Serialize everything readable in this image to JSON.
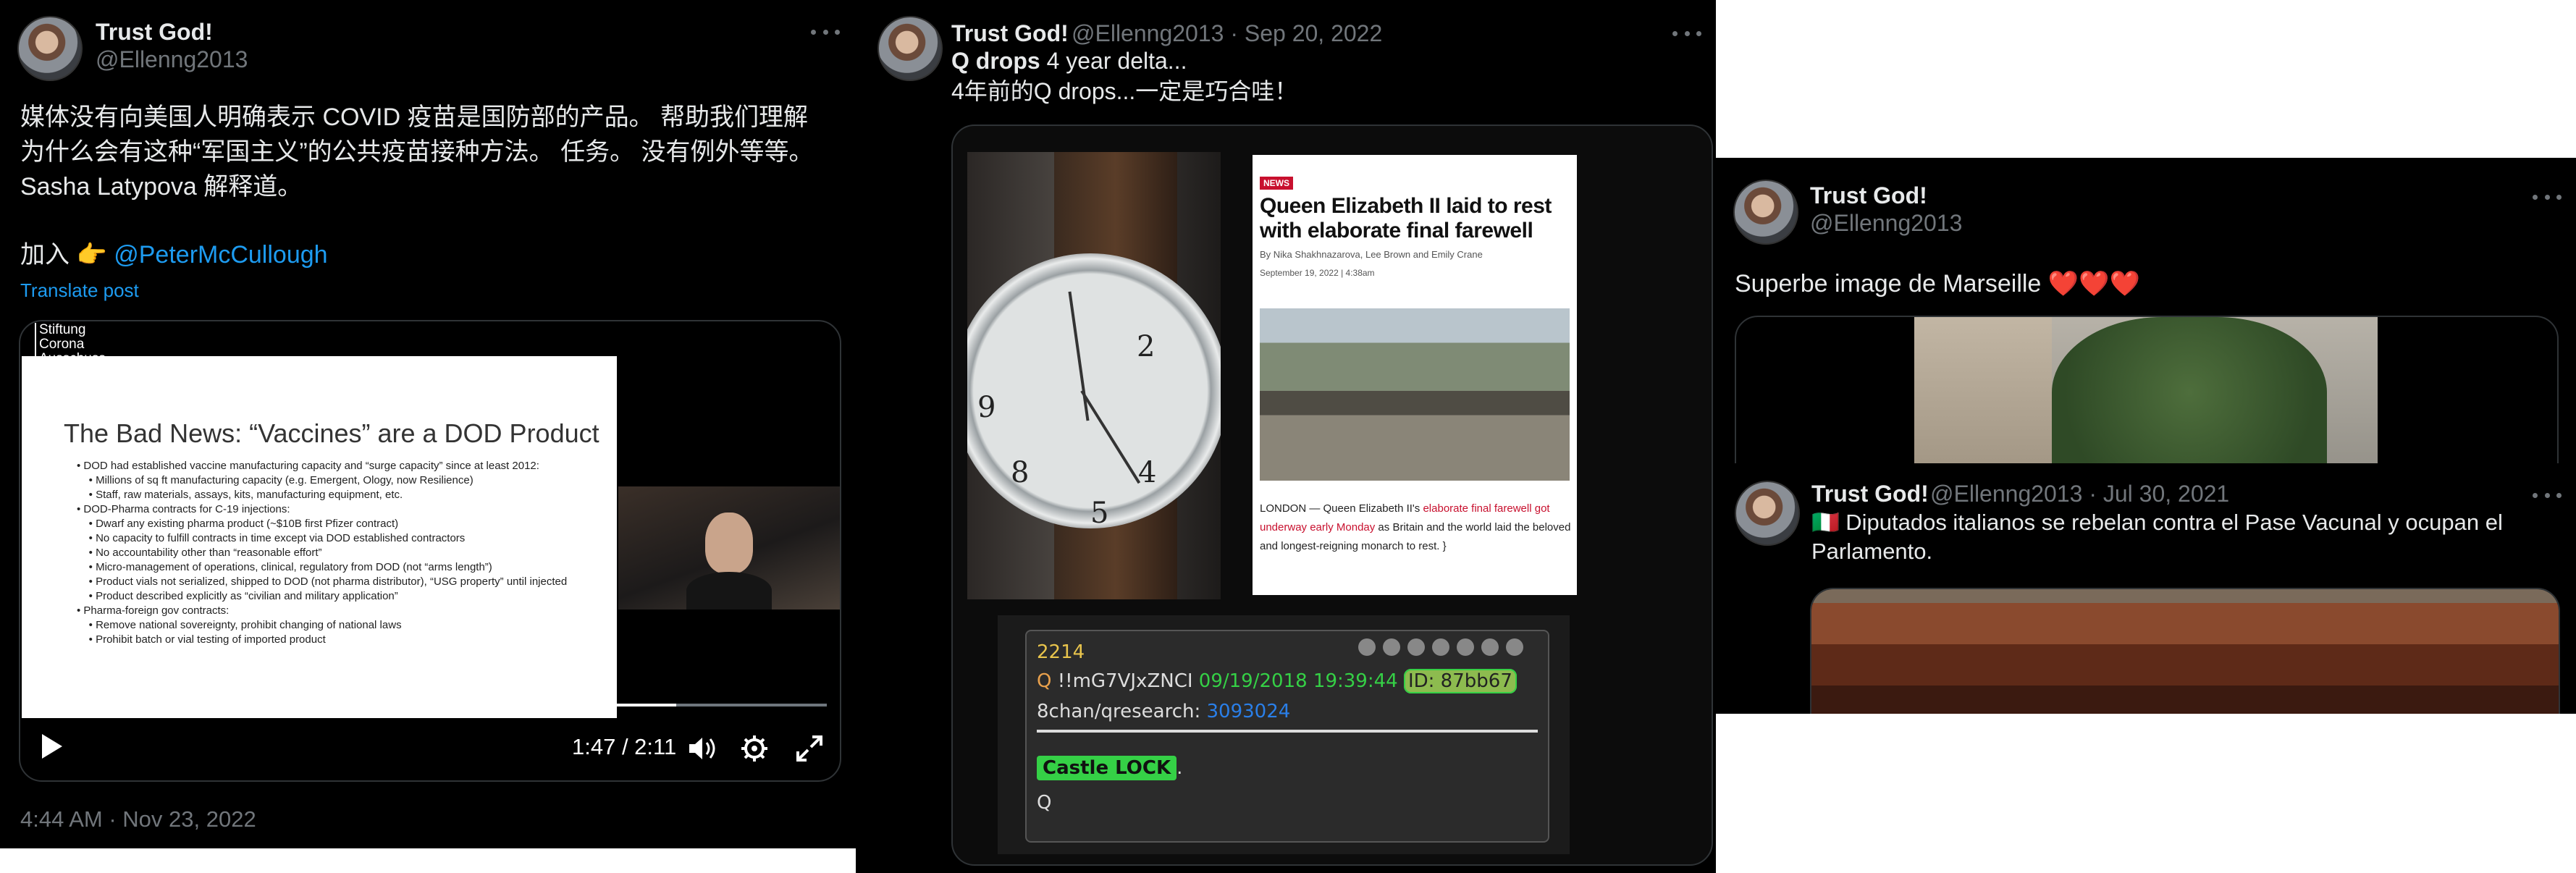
{
  "tweet1": {
    "name": "Trust God!",
    "handle": "@Ellenng2013",
    "line1": "媒体没有向美国人明确表示 COVID 疫苗是国防部的产品。 帮助我们理解",
    "line2": "为什么会有这种“军国主义”的公共疫苗接种方法。 任务。 没有例外等等。",
    "line3": "Sasha Latypova 解释道。",
    "join_text": "加入 👉",
    "mention": "@PeterMcCullough",
    "translate": "Translate post",
    "timestamp": "4:44 AM · Nov 23, 2022",
    "video": {
      "watermark_l1": "Stiftung",
      "watermark_l2": "Corona",
      "watermark_l3": "Ausschuss",
      "slide_title": "The Bad News: “Vaccines” are a DOD Product",
      "slide_bullets": [
        "• DOD had established vaccine manufacturing capacity and “surge capacity” since at least 2012:",
        "    • Millions of sq ft manufacturing capacity (e.g. Emergent, Ology, now Resilience)",
        "    • Staff, raw materials, assays, kits, manufacturing equipment, etc.",
        "• DOD-Pharma contracts for C-19 injections:",
        "    • Dwarf any existing pharma product (~$10B first Pfizer contract)",
        "    • No capacity to fulfill contracts in time except via DOD established contractors",
        "    • No accountability other than “reasonable effort”",
        "    • Micro-management of operations, clinical, regulatory from DOD (not “arms length”)",
        "    • Product vials not serialized, shipped to DOD (not pharma distributor), “USG property” until injected",
        "    • Product described explicitly as “civilian and military application”",
        "• Pharma-foreign gov contracts:",
        "    • Remove national sovereignty, prohibit changing of national laws",
        "    • Prohibit batch or vial testing of imported product"
      ],
      "time": "1:47 / 2:11",
      "progress": 0.81
    }
  },
  "tweet2": {
    "name": "Trust God!",
    "handle": "@Ellenng2013",
    "date": "· Sep 20, 2022",
    "title_bold": "Q drops",
    "title_rest": " 4 year delta...",
    "subtitle": "4年前的Q drops...一定是巧合哇！",
    "article": {
      "tag": "NEWS",
      "headline": "Queen Elizabeth II laid to rest with elaborate final farewell",
      "byline": "By Nika Shakhnazarova, Lee Brown and Emily Crane",
      "dateline": "September 19, 2022 | 4:38am",
      "body_pre": "LONDON — Queen Elizabeth II's ",
      "body_link": "elaborate final farewell got underway early Monday",
      "body_post": " as Britain and the world laid the beloved and longest-reigning monarch to rest."
    },
    "qpost": {
      "number": "2214",
      "q": "Q",
      "trip": "!!mG7VJxZNCI",
      "datetime": "09/19/2018 19:39:44",
      "id": "ID: 87bb67",
      "board": "8chan/qresearch:",
      "ref": "3093024",
      "tag": "Castle LOCK",
      "dot": ".",
      "sign": "Q"
    }
  },
  "tweet3": {
    "name": "Trust God!",
    "handle": "@Ellenng2013",
    "text": "Superbe image de Marseille",
    "hearts": "❤️❤️❤️"
  },
  "tweet4": {
    "name": "Trust God!",
    "handle": "@Ellenng2013",
    "date": "· Jul 30, 2021",
    "flag": "🇮🇹",
    "line1": " Diputados italianos se rebelan contra el Pase Vacunal y ocupan el",
    "line2": "Parlamento."
  },
  "colors": {
    "link": "#1d9bf0",
    "muted": "#71767b",
    "text": "#e7e9ea",
    "qgreen": "#35d046",
    "qyellow": "#e8c44c"
  },
  "icons": [
    "more-icon",
    "play-icon",
    "volume-icon",
    "settings-icon",
    "fullscreen-icon",
    "pointing-hand-icon",
    "heart-icon",
    "italy-flag-icon"
  ]
}
